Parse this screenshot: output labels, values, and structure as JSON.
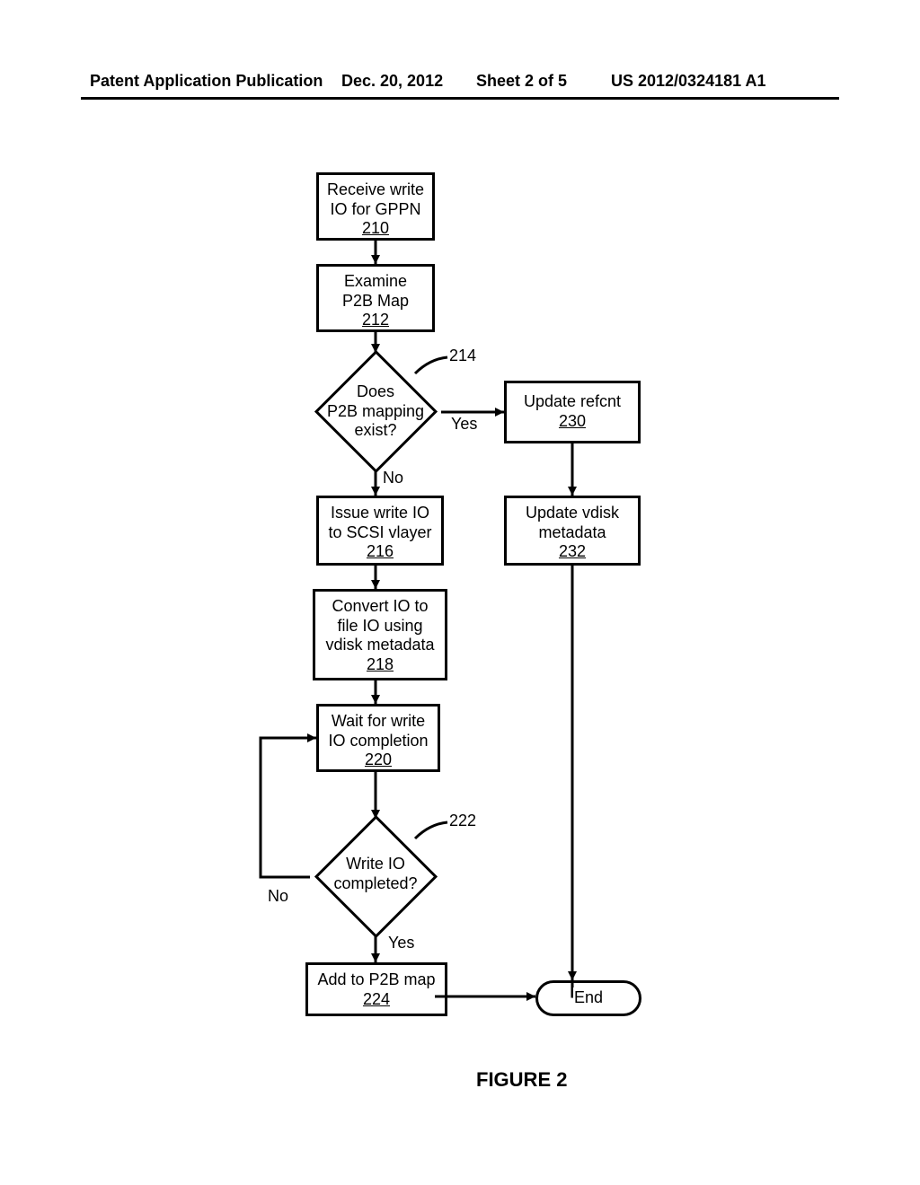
{
  "header": {
    "left": "Patent Application Publication",
    "date": "Dec. 20, 2012",
    "sheet": "Sheet 2 of 5",
    "pubno": "US 2012/0324181 A1"
  },
  "nodes": {
    "n210": {
      "line1": "Receive write",
      "line2": "IO for GPPN",
      "ref": "210"
    },
    "n212": {
      "line1": "Examine",
      "line2": "P2B Map",
      "ref": "212"
    },
    "d214": {
      "line1": "Does",
      "line2": "P2B mapping",
      "line3": "exist?",
      "ref": "214"
    },
    "n216": {
      "line1": "Issue write IO",
      "line2": "to SCSI vlayer",
      "ref": "216"
    },
    "n218": {
      "line1": "Convert IO to",
      "line2": "file IO using",
      "line3": "vdisk metadata",
      "ref": "218"
    },
    "n220": {
      "line1": "Wait for write",
      "line2": "IO completion",
      "ref": "220"
    },
    "d222": {
      "line1": "Write IO",
      "line2": "completed?",
      "ref": "222"
    },
    "n224": {
      "line1": "Add to P2B map",
      "ref": "224"
    },
    "n230": {
      "line1": "Update refcnt",
      "ref": "230"
    },
    "n232": {
      "line1": "Update vdisk",
      "line2": "metadata",
      "ref": "232"
    },
    "end": {
      "label": "End"
    }
  },
  "edgeLabels": {
    "d214_yes": "Yes",
    "d214_no": "No",
    "d222_yes": "Yes",
    "d222_no": "No"
  },
  "figure": "FIGURE 2"
}
